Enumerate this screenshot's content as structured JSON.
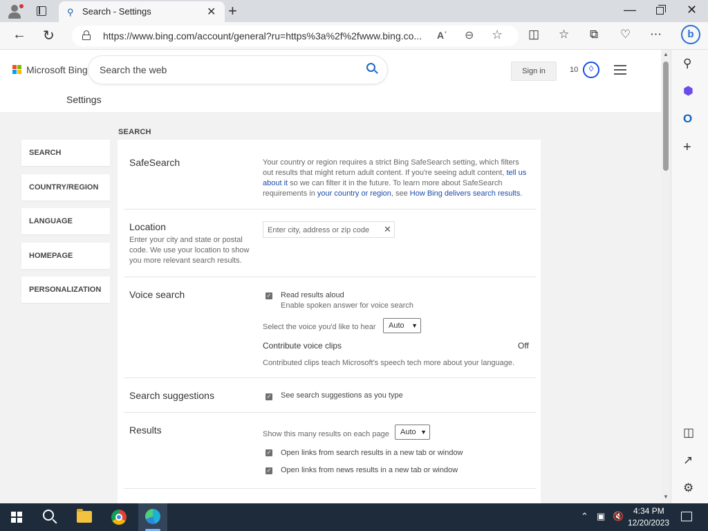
{
  "browser": {
    "tab_title": "Search - Settings",
    "url": "https://www.bing.com/account/general?ru=https%3a%2f%2fwww.bing.co..."
  },
  "bing": {
    "logo_text": "Microsoft Bing",
    "search_placeholder": "Search the web",
    "sign_in_label": "Sign in",
    "rewards_count": "10",
    "page_title": "Settings"
  },
  "side_nav": [
    {
      "label": "SEARCH"
    },
    {
      "label": "COUNTRY/REGION"
    },
    {
      "label": "LANGUAGE"
    },
    {
      "label": "HOMEPAGE"
    },
    {
      "label": "PERSONALIZATION"
    }
  ],
  "section_heading": "SEARCH",
  "safesearch": {
    "title": "SafeSearch",
    "text_1": "Your country or region requires a strict Bing SafeSearch setting, which filters out results that might return adult content. If you're seeing adult content, ",
    "link_tell": "tell us about it",
    "text_2": " so we can filter it in the future. To learn more about SafeSearch requirements in ",
    "link_region": "your country or region",
    "text_3": ", see ",
    "link_how": "How Bing delivers search results",
    "text_4": "."
  },
  "location": {
    "title": "Location",
    "description": "Enter your city and state or postal code. We use your location to show you more relevant search results.",
    "placeholder": "Enter city, address or zip code"
  },
  "voice": {
    "title": "Voice search",
    "read_aloud_label": "Read results aloud",
    "read_aloud_checked": true,
    "read_aloud_desc": "Enable spoken answer for voice search",
    "voice_select_label": "Select the voice you'd like to hear",
    "voice_select_value": "Auto",
    "contribute_title": "Contribute voice clips",
    "contribute_state": "Off",
    "contribute_desc": "Contributed clips teach Microsoft's speech tech more about your language."
  },
  "suggestions": {
    "title": "Search suggestions",
    "label": "See search suggestions as you type",
    "checked": true
  },
  "results": {
    "title": "Results",
    "per_page_label": "Show this many results on each page",
    "per_page_value": "Auto",
    "open_search_label": "Open links from search results in a new tab or window",
    "open_news_label": "Open links from news results in a new tab or window"
  },
  "taskbar": {
    "time": "4:34 PM",
    "date": "12/20/2023"
  },
  "colors": {
    "accent": "#1a66c4",
    "link": "#1a4aab",
    "rewards": "#174ae4",
    "taskbar": "#1d2b3a"
  }
}
